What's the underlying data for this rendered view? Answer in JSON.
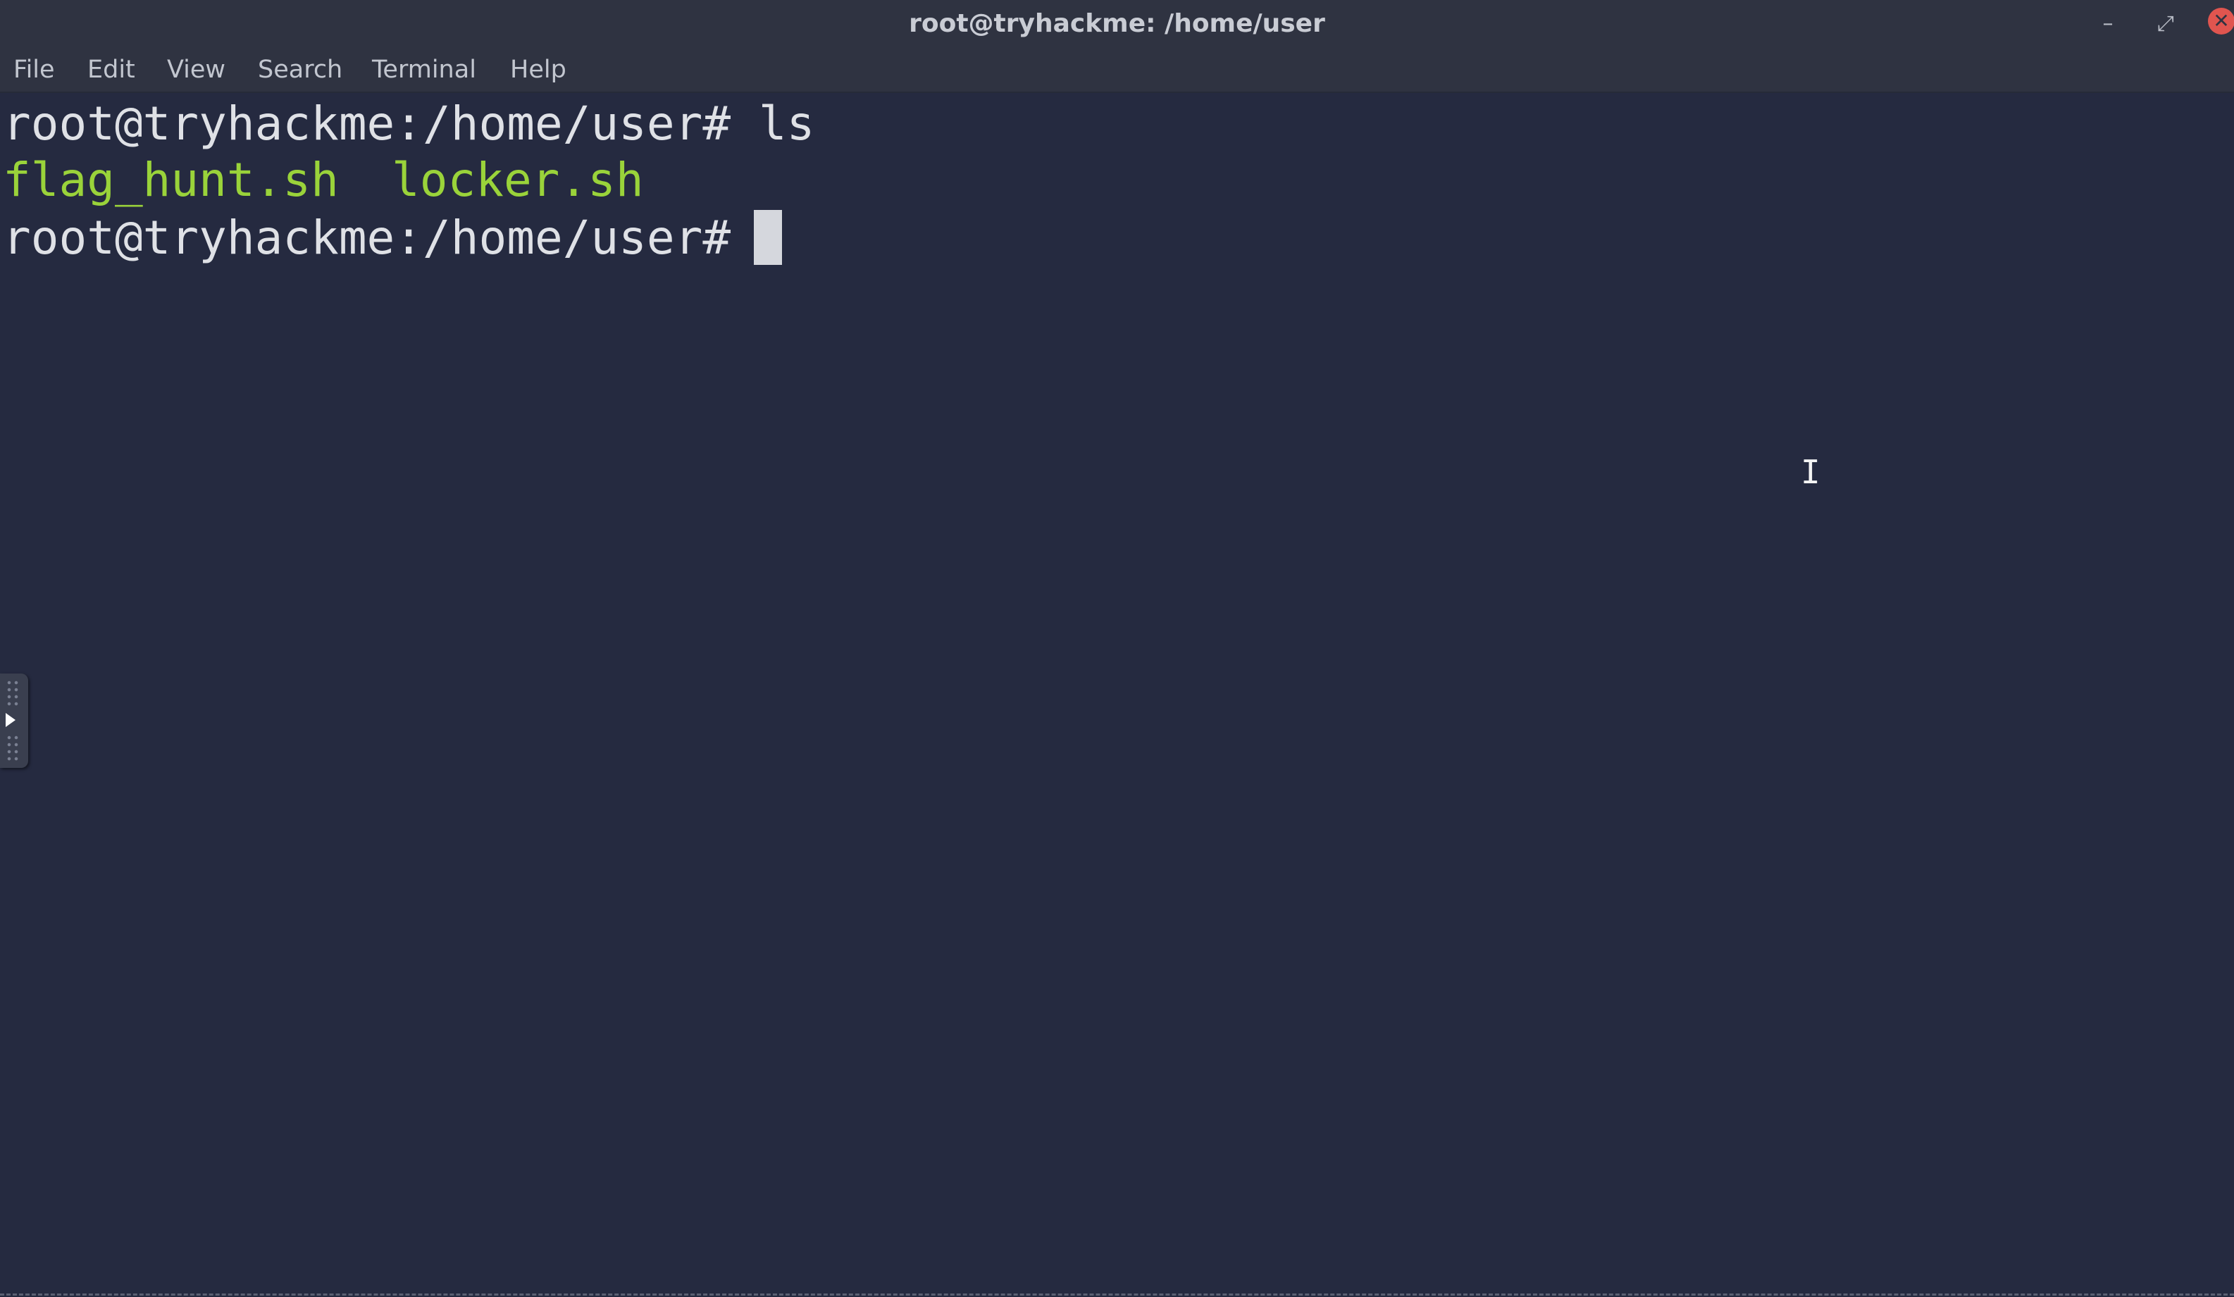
{
  "window": {
    "title": "root@tryhackme: /home/user",
    "minimize_glyph": "–",
    "maximize_glyph": "⤢",
    "close_glyph": "✕"
  },
  "menu": {
    "items": [
      {
        "label": "File"
      },
      {
        "label": "Edit"
      },
      {
        "label": "View"
      },
      {
        "label": "Search"
      },
      {
        "label": "Terminal"
      },
      {
        "label": "Help"
      }
    ]
  },
  "terminal": {
    "line1": "root@tryhackme:/home/user# ls",
    "files": [
      "flag_hunt.sh",
      "locker.sh"
    ],
    "line3": "root@tryhackme:/home/user# ",
    "file_color": "#9ad33a",
    "text_color": "#dfe1e6",
    "background": "#252a40"
  },
  "icons": {
    "mouse_cursor": "ibeam-cursor-icon",
    "side_handle_arrow": "play-arrow-icon"
  }
}
